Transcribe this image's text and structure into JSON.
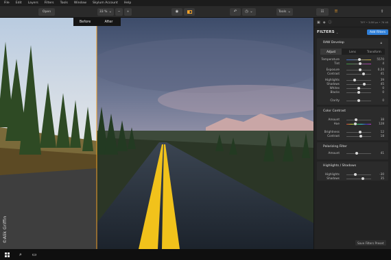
{
  "menu": [
    "File",
    "Edit",
    "Layers",
    "Filters",
    "Tools",
    "Window",
    "Skylum Account",
    "Help"
  ],
  "toolbar": {
    "open_label": "Open",
    "zoom_label": "33 %",
    "zoom_out": "−",
    "zoom_in": "+",
    "tools_label": "Tools"
  },
  "viewer": {
    "before_label": "Before",
    "after_label": "After",
    "watermark": "©Alik Griffin"
  },
  "panel": {
    "file_info": "TIFF • 3.8M px • 76 kB",
    "filters_title": "FILTERS",
    "add_filters_label": "Add Filters",
    "raw": {
      "title": "RAW Develop",
      "tabs": [
        "Adjust",
        "Lens",
        "Transform"
      ],
      "active_tab": "Adjust",
      "group1": [
        {
          "label": "Temperature",
          "value": "5570",
          "pos": 0.52
        },
        {
          "label": "Tint",
          "value": "4",
          "pos": 0.55
        }
      ],
      "group2": [
        {
          "label": "Exposure",
          "value": "0.24",
          "pos": 0.56
        },
        {
          "label": "Contrast",
          "value": "41",
          "pos": 0.7
        }
      ],
      "group3": [
        {
          "label": "Highlights",
          "value": "39",
          "pos": 0.32
        },
        {
          "label": "Shadows",
          "value": "45",
          "pos": 0.72
        },
        {
          "label": "Whites",
          "value": "0",
          "pos": 0.5
        },
        {
          "label": "Blacks",
          "value": "0",
          "pos": 0.5
        }
      ],
      "group4": [
        {
          "label": "Clarity",
          "value": "0",
          "pos": 0.5
        }
      ]
    },
    "color_contrast": {
      "title": "Color Contrast",
      "group1": [
        {
          "label": "Amount",
          "value": "38",
          "pos": 0.38
        },
        {
          "label": "Hue",
          "value": "128",
          "pos": 0.35
        }
      ],
      "group2": [
        {
          "label": "Brightness",
          "value": "12",
          "pos": 0.56
        },
        {
          "label": "Contrast",
          "value": "18",
          "pos": 0.59
        }
      ]
    },
    "polarizing": {
      "title": "Polarizing Filter",
      "rows": [
        {
          "label": "Amount",
          "value": "41",
          "pos": 0.41
        }
      ]
    },
    "highlights_shadows": {
      "title": "Highlights / Shadows",
      "rows": [
        {
          "label": "Highlights",
          "value": "-30",
          "pos": 0.35
        },
        {
          "label": "Shadows",
          "value": "35",
          "pos": 0.68
        }
      ]
    },
    "save_preset_label": "Save Filters Preset"
  },
  "colors": {
    "accent": "#2f7fd8",
    "divider": "#f3a22a"
  }
}
